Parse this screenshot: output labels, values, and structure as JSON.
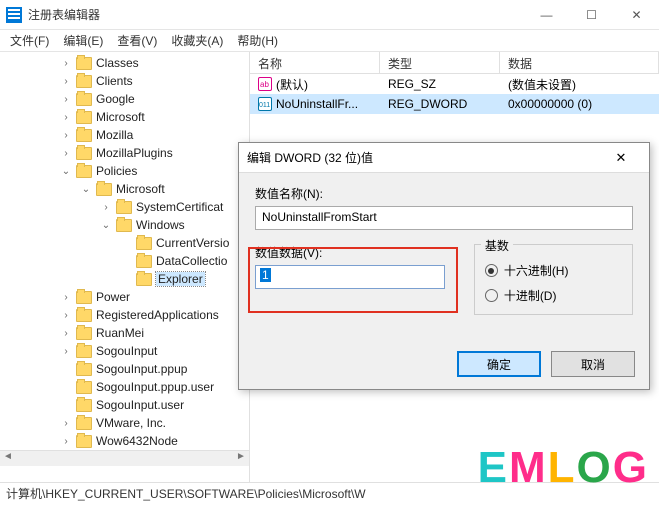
{
  "window": {
    "title": "注册表编辑器"
  },
  "menubar": [
    "文件(F)",
    "编辑(E)",
    "查看(V)",
    "收藏夹(A)",
    "帮助(H)"
  ],
  "tree": [
    {
      "indent": 60,
      "twist": ">",
      "label": "Classes"
    },
    {
      "indent": 60,
      "twist": ">",
      "label": "Clients"
    },
    {
      "indent": 60,
      "twist": ">",
      "label": "Google"
    },
    {
      "indent": 60,
      "twist": ">",
      "label": "Microsoft"
    },
    {
      "indent": 60,
      "twist": ">",
      "label": "Mozilla"
    },
    {
      "indent": 60,
      "twist": ">",
      "label": "MozillaPlugins"
    },
    {
      "indent": 60,
      "twist": "v",
      "label": "Policies"
    },
    {
      "indent": 80,
      "twist": "v",
      "label": "Microsoft"
    },
    {
      "indent": 100,
      "twist": ">",
      "label": "SystemCertificat"
    },
    {
      "indent": 100,
      "twist": "v",
      "label": "Windows"
    },
    {
      "indent": 120,
      "twist": "",
      "label": "CurrentVersio"
    },
    {
      "indent": 120,
      "twist": "",
      "label": "DataCollectio"
    },
    {
      "indent": 120,
      "twist": "",
      "label": "Explorer",
      "selected": true
    },
    {
      "indent": 60,
      "twist": ">",
      "label": "Power"
    },
    {
      "indent": 60,
      "twist": ">",
      "label": "RegisteredApplications"
    },
    {
      "indent": 60,
      "twist": ">",
      "label": "RuanMei"
    },
    {
      "indent": 60,
      "twist": ">",
      "label": "SogouInput"
    },
    {
      "indent": 60,
      "twist": "",
      "label": "SogouInput.ppup"
    },
    {
      "indent": 60,
      "twist": "",
      "label": "SogouInput.ppup.user"
    },
    {
      "indent": 60,
      "twist": "",
      "label": "SogouInput.user"
    },
    {
      "indent": 60,
      "twist": ">",
      "label": "VMware, Inc."
    },
    {
      "indent": 60,
      "twist": ">",
      "label": "Wow6432Node"
    }
  ],
  "list": {
    "headers": {
      "name": "名称",
      "type": "类型",
      "data": "数据"
    },
    "rows": [
      {
        "icon": "ab",
        "name": "(默认)",
        "type": "REG_SZ",
        "data": "(数值未设置)",
        "selected": false
      },
      {
        "icon": "num",
        "name": "NoUninstallFr...",
        "type": "REG_DWORD",
        "data": "0x00000000 (0)",
        "selected": true
      }
    ]
  },
  "statusbar": "计算机\\HKEY_CURRENT_USER\\SOFTWARE\\Policies\\Microsoft\\W",
  "dialog": {
    "title": "编辑 DWORD (32 位)值",
    "name_label": "数值名称(N):",
    "name_value": "NoUninstallFromStart",
    "data_label": "数值数据(V):",
    "data_value": "1",
    "radix_legend": "基数",
    "radix_hex": "十六进制(H)",
    "radix_dec": "十进制(D)",
    "ok": "确定",
    "cancel": "取消"
  },
  "watermark": "EMLOG"
}
